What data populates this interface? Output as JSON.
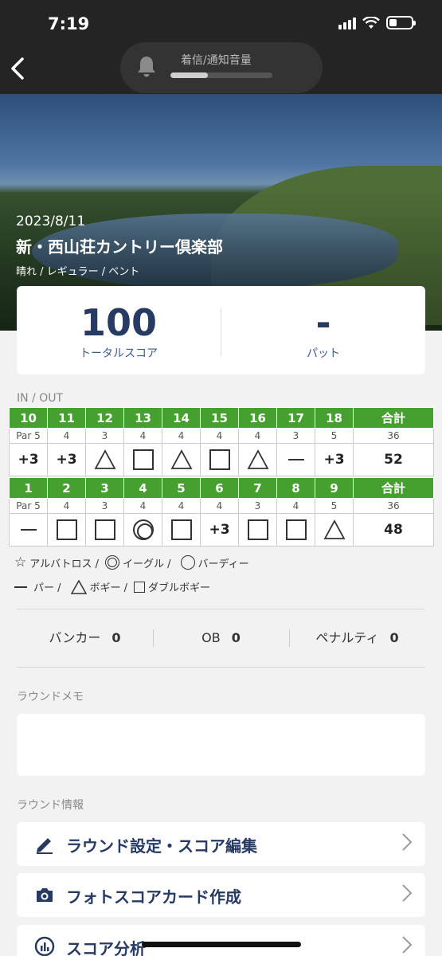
{
  "status_bar": {
    "time": "7:19"
  },
  "volume_hud": {
    "label": "着信/通知音量",
    "level": 0.37
  },
  "round": {
    "date": "2023/8/11",
    "course": "新・西山荘カントリー倶楽部",
    "meta": "晴れ / レギュラー  / ベント"
  },
  "summary": {
    "total_score": "100",
    "total_label": "トータルスコア",
    "putts": "-",
    "putts_label": "パット"
  },
  "scorecard": {
    "label": "IN / OUT",
    "total_header": "合計",
    "in": {
      "holes": [
        "10",
        "11",
        "12",
        "13",
        "14",
        "15",
        "16",
        "17",
        "18"
      ],
      "pars": [
        "Par 5",
        "4",
        "3",
        "4",
        "4",
        "4",
        "4",
        "3",
        "5"
      ],
      "par_total": "36",
      "results": [
        "+3",
        "+3",
        "bogey",
        "double",
        "bogey",
        "double",
        "bogey",
        "par",
        "+3"
      ],
      "total": "52"
    },
    "out": {
      "holes": [
        "1",
        "2",
        "3",
        "4",
        "5",
        "6",
        "7",
        "8",
        "9"
      ],
      "pars": [
        "Par 5",
        "4",
        "3",
        "4",
        "4",
        "4",
        "3",
        "4",
        "5"
      ],
      "par_total": "36",
      "results": [
        "par",
        "double",
        "double",
        "eagle",
        "double",
        "+3",
        "double",
        "double",
        "bogey"
      ],
      "total": "48"
    }
  },
  "legend": {
    "albatross": "アルバトロス /",
    "eagle": "イーグル /",
    "birdie": "バーディー",
    "par": "パー /",
    "bogey": "ボギー /",
    "double": "ダブルボギー"
  },
  "stats": {
    "bunker_label": "バンカー",
    "bunker_value": "0",
    "ob_label": "OB",
    "ob_value": "0",
    "penalty_label": "ペナルティ",
    "penalty_value": "0"
  },
  "memo": {
    "label": "ラウンドメモ"
  },
  "info": {
    "label": "ラウンド情報",
    "items": [
      {
        "label": "ラウンド設定・スコア編集",
        "icon": "pencil-icon"
      },
      {
        "label": "フォトスコアカード作成",
        "icon": "camera-icon"
      },
      {
        "label": "スコア分析",
        "icon": "chart-icon"
      }
    ]
  },
  "colors": {
    "accent_green": "#45a030",
    "navy": "#263a63"
  }
}
